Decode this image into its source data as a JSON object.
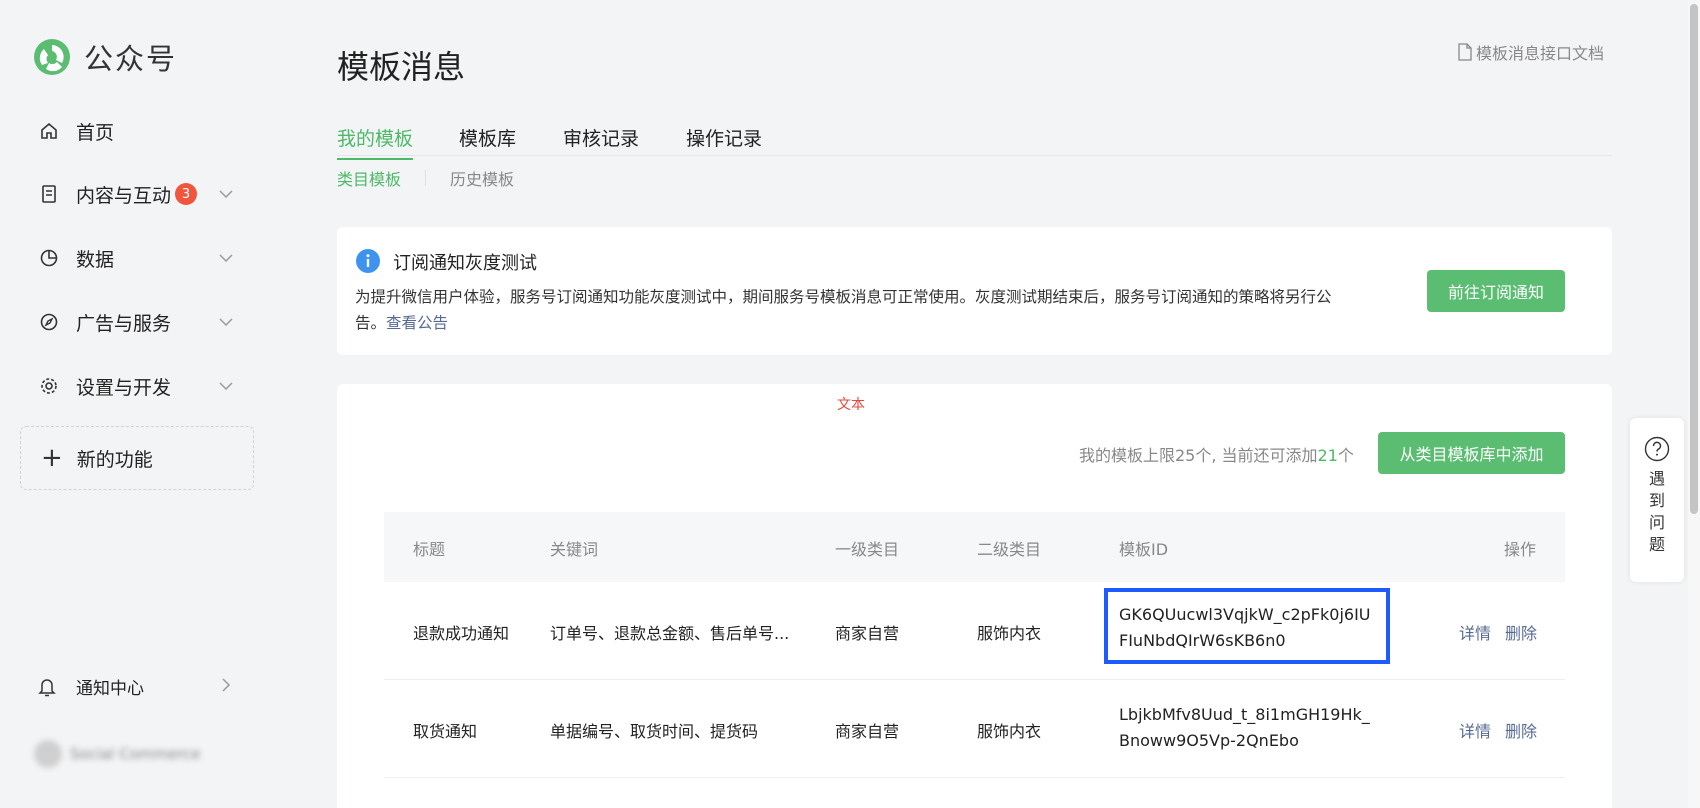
{
  "brand": {
    "name": "公众号"
  },
  "sidebar": {
    "items": [
      {
        "label": "首页",
        "icon": "home-icon"
      },
      {
        "label": "内容与互动",
        "icon": "document-icon",
        "badge": "3"
      },
      {
        "label": "数据",
        "icon": "pie-chart-icon"
      },
      {
        "label": "广告与服务",
        "icon": "compass-icon"
      },
      {
        "label": "设置与开发",
        "icon": "gear-icon"
      }
    ],
    "new_feature": "新的功能",
    "notification_center": "通知中心",
    "account_name": "Social Commerce"
  },
  "page": {
    "title": "模板消息",
    "doc_link": "模板消息接口文档"
  },
  "tabs": [
    "我的模板",
    "模板库",
    "审核记录",
    "操作记录"
  ],
  "subtabs": [
    "类目模板",
    "历史模板"
  ],
  "notice": {
    "title": "订阅通知灰度测试",
    "body": "为提升微信用户体验，服务号订阅通知功能灰度测试中，期间服务号模板消息可正常使用。灰度测试期结束后，服务号订阅通知的策略将另行公告。",
    "link": "查看公告",
    "button": "前往订阅通知"
  },
  "list": {
    "debug_tag": "文本",
    "limit_prefix": "我的模板上限25个, 当前还可添加",
    "limit_num": "21",
    "limit_suffix": "个",
    "add_button": "从类目模板库中添加",
    "columns": [
      "标题",
      "关键词",
      "一级类目",
      "二级类目",
      "模板ID",
      "操作"
    ],
    "rows": [
      {
        "title": "退款成功通知",
        "keywords": "订单号、退款总金额、售后单号...",
        "cat1": "商家自营",
        "cat2": "服饰内衣",
        "id": "GK6QUucwl3VqjkW_c2pFk0j6IUFIuNbdQIrW6sKB6n0",
        "detail": "详情",
        "delete": "删除"
      },
      {
        "title": "取货通知",
        "keywords": "单据编号、取货时间、提货码",
        "cat1": "商家自营",
        "cat2": "服饰内衣",
        "id": "LbjkbMfv8Uud_t_8i1mGH19Hk_Bnoww9O5Vp-2QnEbo",
        "detail": "详情",
        "delete": "删除"
      }
    ]
  },
  "help": {
    "text": "遇到问题"
  },
  "colors": {
    "accent": "#4eb968",
    "link": "#576b95",
    "badge": "#f0563d",
    "highlight": "#1d5bff"
  }
}
